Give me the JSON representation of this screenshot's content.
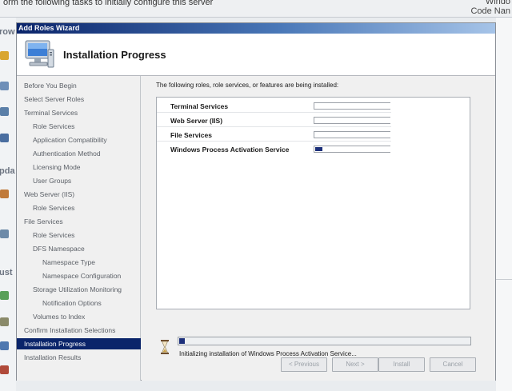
{
  "background": {
    "top_text": "orm the following tasks to initially configure this server",
    "brand_line1": "Windo",
    "brand_line2": "Code Nan",
    "left_labels": [
      "row",
      "pda",
      "ust"
    ]
  },
  "wizard": {
    "title": "Add Roles Wizard",
    "header_title": "Installation Progress",
    "nav": [
      {
        "label": "Before You Begin",
        "level": 1,
        "active": false
      },
      {
        "label": "Select Server Roles",
        "level": 1,
        "active": false
      },
      {
        "label": "Terminal Services",
        "level": 1,
        "active": false
      },
      {
        "label": "Role Services",
        "level": 2,
        "active": false
      },
      {
        "label": "Application Compatibility",
        "level": 2,
        "active": false
      },
      {
        "label": "Authentication Method",
        "level": 2,
        "active": false
      },
      {
        "label": "Licensing Mode",
        "level": 2,
        "active": false
      },
      {
        "label": "User Groups",
        "level": 2,
        "active": false
      },
      {
        "label": "Web Server (IIS)",
        "level": 1,
        "active": false
      },
      {
        "label": "Role Services",
        "level": 2,
        "active": false
      },
      {
        "label": "File Services",
        "level": 1,
        "active": false
      },
      {
        "label": "Role Services",
        "level": 2,
        "active": false
      },
      {
        "label": "DFS Namespace",
        "level": 2,
        "active": false
      },
      {
        "label": "Namespace Type",
        "level": 3,
        "active": false
      },
      {
        "label": "Namespace Configuration",
        "level": 3,
        "active": false
      },
      {
        "label": "Storage Utilization Monitoring",
        "level": 2,
        "active": false
      },
      {
        "label": "Notification Options",
        "level": 3,
        "active": false
      },
      {
        "label": "Volumes to Index",
        "level": 2,
        "active": false
      },
      {
        "label": "Confirm Installation Selections",
        "level": 1,
        "active": false
      },
      {
        "label": "Installation Progress",
        "level": 1,
        "active": true
      },
      {
        "label": "Installation Results",
        "level": 1,
        "active": false
      }
    ],
    "intro": "The following roles, role services, or features are being installed:",
    "items": [
      {
        "name": "Terminal Services",
        "progress": 0
      },
      {
        "name": "Web Server (IIS)",
        "progress": 0
      },
      {
        "name": "File Services",
        "progress": 0
      },
      {
        "name": "Windows Process Activation Service",
        "progress": 0.1
      }
    ],
    "status_progress": 0.02,
    "status_text": "Initializing installation of Windows Process Activation Service...",
    "buttons": {
      "previous": "< Previous",
      "next": "Next >",
      "install": "Install",
      "cancel": "Cancel"
    },
    "colors": {
      "accent": "#0a246a",
      "progress_fill": "#1c2f7a"
    }
  }
}
